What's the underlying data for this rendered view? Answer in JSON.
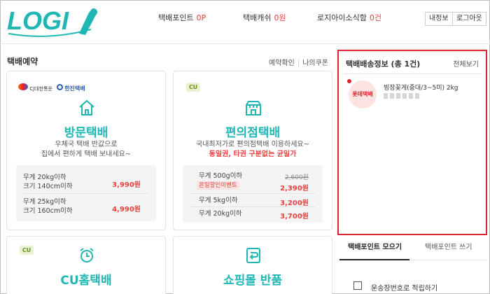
{
  "header": {
    "logo_text": "LOGI",
    "stats": [
      {
        "label": "택배포인트",
        "value": "0P"
      },
      {
        "label": "택배캐쉬",
        "value": "0원"
      },
      {
        "label": "로지아이소식함",
        "value": "0건"
      }
    ],
    "buttons": {
      "mypage": "내정보",
      "logout": "로그아웃"
    }
  },
  "section": {
    "title": "택배예약",
    "links": {
      "confirm": "예약확인",
      "coupon": "나의쿠폰"
    }
  },
  "cards": {
    "visit": {
      "carrier_cj": "CJ대한통운",
      "carrier_hanjin": "한진택배",
      "title": "방문택배",
      "desc1": "우체국 택배 반값으로",
      "desc2": "집에서 편하게 택배 보내세요~",
      "prices": [
        {
          "weight": "무게 20kg이하",
          "size": "크기 140cm이하",
          "price": "3,990원"
        },
        {
          "weight": "무게 25kg이하",
          "size": "크기 160cm이하",
          "price": "4,990원"
        }
      ]
    },
    "convenience": {
      "badge": "CU",
      "title": "편의점택배",
      "desc1": "국내최저가로 편의점택배 이용하세요~",
      "desc2": "동일권, 타권 구분없는 균일가",
      "prices": [
        {
          "weight": "무게 500g이하",
          "old_price": "2,600원",
          "badge": "온일할인이벤트",
          "price": "2,390원"
        },
        {
          "weight": "무게 5kg이하",
          "price": "3,200원"
        },
        {
          "weight": "무게 20kg이하",
          "price": "3,700원"
        }
      ]
    },
    "cu_home": {
      "badge": "CU",
      "title": "CU홈택배"
    },
    "mall_return": {
      "title": "쇼핑몰 반품"
    }
  },
  "tracking": {
    "title": "택배배송정보 (총 1건)",
    "view_all": "전체보기",
    "carrier": "롯데택배",
    "item": "빙장꽃게(중대/3~5미) 2kg"
  },
  "points": {
    "tabs": [
      "택배포인트 모으기",
      "택배포인트 쓰기"
    ],
    "link": "운송장번호로 적립하기"
  },
  "colors": {
    "accent": "#1fb6b4",
    "price_red": "#e8413f",
    "highlight_border": "#e0242d"
  }
}
